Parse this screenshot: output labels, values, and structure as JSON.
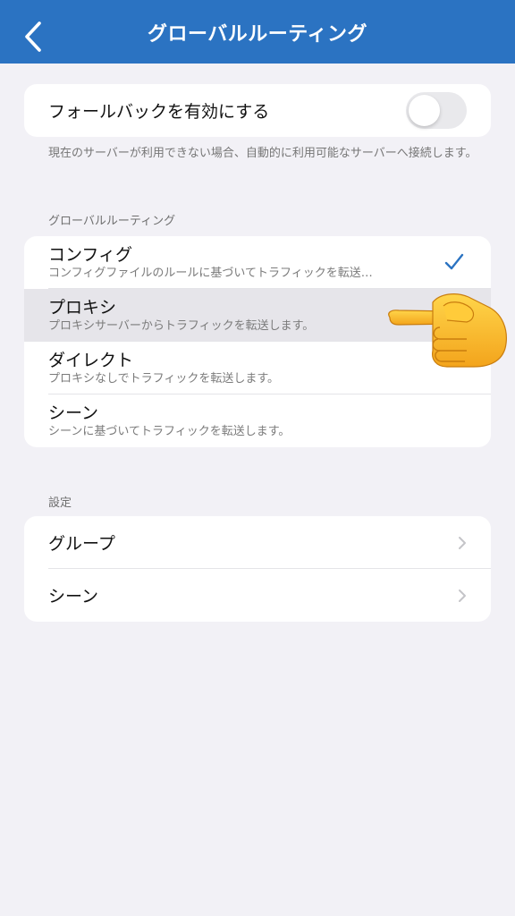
{
  "navbar": {
    "title": "グローバルルーティング",
    "back_icon": "chevron-left-icon",
    "background": "#2b73c2"
  },
  "fallback": {
    "label": "フォールバックを有効にする",
    "enabled": false,
    "description": "現在のサーバーが利用できない場合、自動的に利用可能なサーバーへ接続します。"
  },
  "routing": {
    "section_title": "グローバルルーティング",
    "selected_index": 0,
    "options": [
      {
        "title": "コンフィグ",
        "subtitle": "コンフィグファイルのルールに基づいてトラフィックを転送…"
      },
      {
        "title": "プロキシ",
        "subtitle": "プロキシサーバーからトラフィックを転送します。"
      },
      {
        "title": "ダイレクト",
        "subtitle": "プロキシなしでトラフィックを転送します。"
      },
      {
        "title": "シーン",
        "subtitle": "シーンに基づいてトラフィックを転送します。"
      }
    ]
  },
  "settings": {
    "section_title": "設定",
    "items": [
      {
        "label": "グループ"
      },
      {
        "label": "シーン"
      }
    ]
  },
  "annotation": {
    "icon": "pointing-hand-icon"
  }
}
